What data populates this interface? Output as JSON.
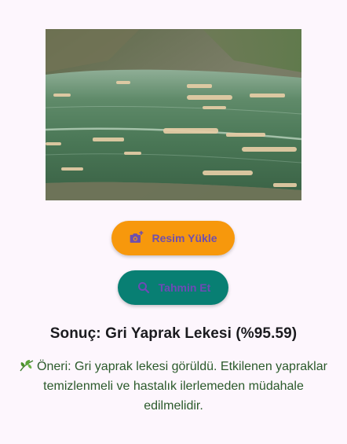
{
  "image": {
    "subject": "corn-leaf-gray-leaf-spot-photo"
  },
  "buttons": {
    "upload_label": "Resim Yükle",
    "predict_label": "Tahmin Et"
  },
  "result": {
    "text": "Sonuç: Gri Yaprak Lekesi (%95.59)"
  },
  "advice": {
    "icon": "leaf-emoji",
    "text": "Öneri: Gri yaprak lekesi görüldü. Etkilenen yapraklar temizlenmeli ve hastalık ilerlemeden müdahale edilmelidir."
  },
  "colors": {
    "background": "#fdf6fd",
    "upload_button": "#f7980c",
    "predict_button": "#087f73",
    "button_text": "#6f4fae",
    "advice_text": "#2b5a2b"
  }
}
